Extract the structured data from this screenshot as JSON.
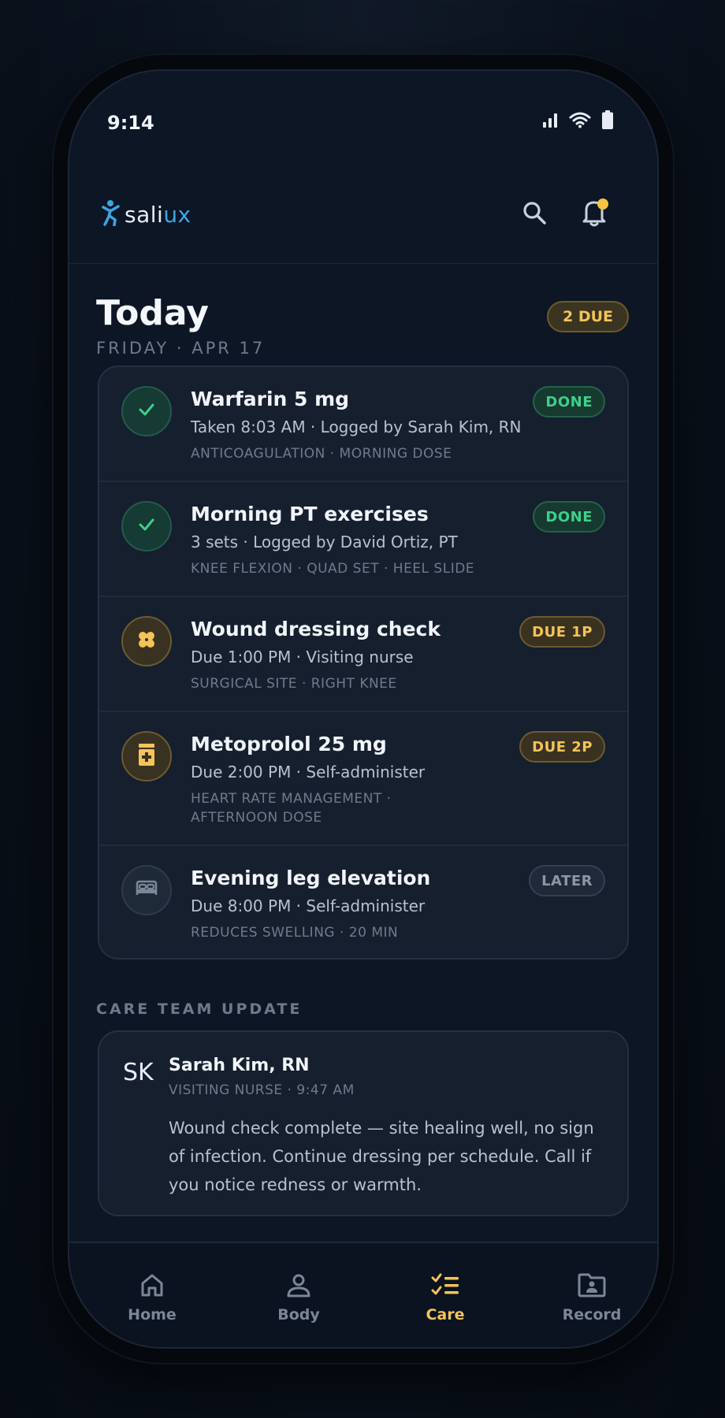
{
  "status_bar": {
    "time": "9:14"
  },
  "header": {
    "logo_text_main": "sali",
    "logo_text_accent": "ux"
  },
  "today": {
    "title": "Today",
    "date": "FRIDAY · APR 17",
    "due_badge": "2 DUE"
  },
  "tasks": [
    {
      "title": "Warfarin 5 mg",
      "subtitle": "Taken 8:03 AM · Logged by Sarah Kim, RN",
      "tags": "ANTICOAGULATION · MORNING DOSE",
      "status": "DONE",
      "icon": "check-icon"
    },
    {
      "title": "Morning PT exercises",
      "subtitle": "3 sets · Logged by David Ortiz, PT",
      "tags": "KNEE FLEXION · QUAD SET · HEEL SLIDE",
      "status": "DONE",
      "icon": "check-icon"
    },
    {
      "title": "Wound dressing check",
      "subtitle": "Due 1:00 PM · Visiting nurse",
      "tags": "SURGICAL SITE · RIGHT KNEE",
      "status": "DUE 1P",
      "icon": "bandage-icon"
    },
    {
      "title": "Metoprolol 25 mg",
      "subtitle": "Due 2:00 PM · Self-administer",
      "tags": "HEART RATE MANAGEMENT · AFTERNOON DOSE",
      "status": "DUE 2P",
      "icon": "pill-bottle-icon"
    },
    {
      "title": "Evening leg elevation",
      "subtitle": "Due 8:00 PM · Self-administer",
      "tags": "REDUCES SWELLING · 20 MIN",
      "status": "LATER",
      "icon": "bed-icon"
    }
  ],
  "care_team": {
    "heading": "CARE TEAM UPDATE",
    "initials": "SK",
    "name": "Sarah Kim, RN",
    "role": "VISITING NURSE · 9:47 AM",
    "message": "Wound check complete — site healing well, no sign of infection. Continue dressing per schedule. Call if you notice redness or warmth."
  },
  "nav": {
    "items": [
      {
        "label": "Home",
        "icon": "home-icon"
      },
      {
        "label": "Body",
        "icon": "person-icon"
      },
      {
        "label": "Care",
        "icon": "checklist-icon",
        "active": true
      },
      {
        "label": "Record",
        "icon": "folder-person-icon"
      }
    ]
  },
  "colors": {
    "accent": "#f4c35a",
    "done": "#3fcf8a",
    "brand": "#3aa6e4",
    "background": "#0d1625"
  }
}
